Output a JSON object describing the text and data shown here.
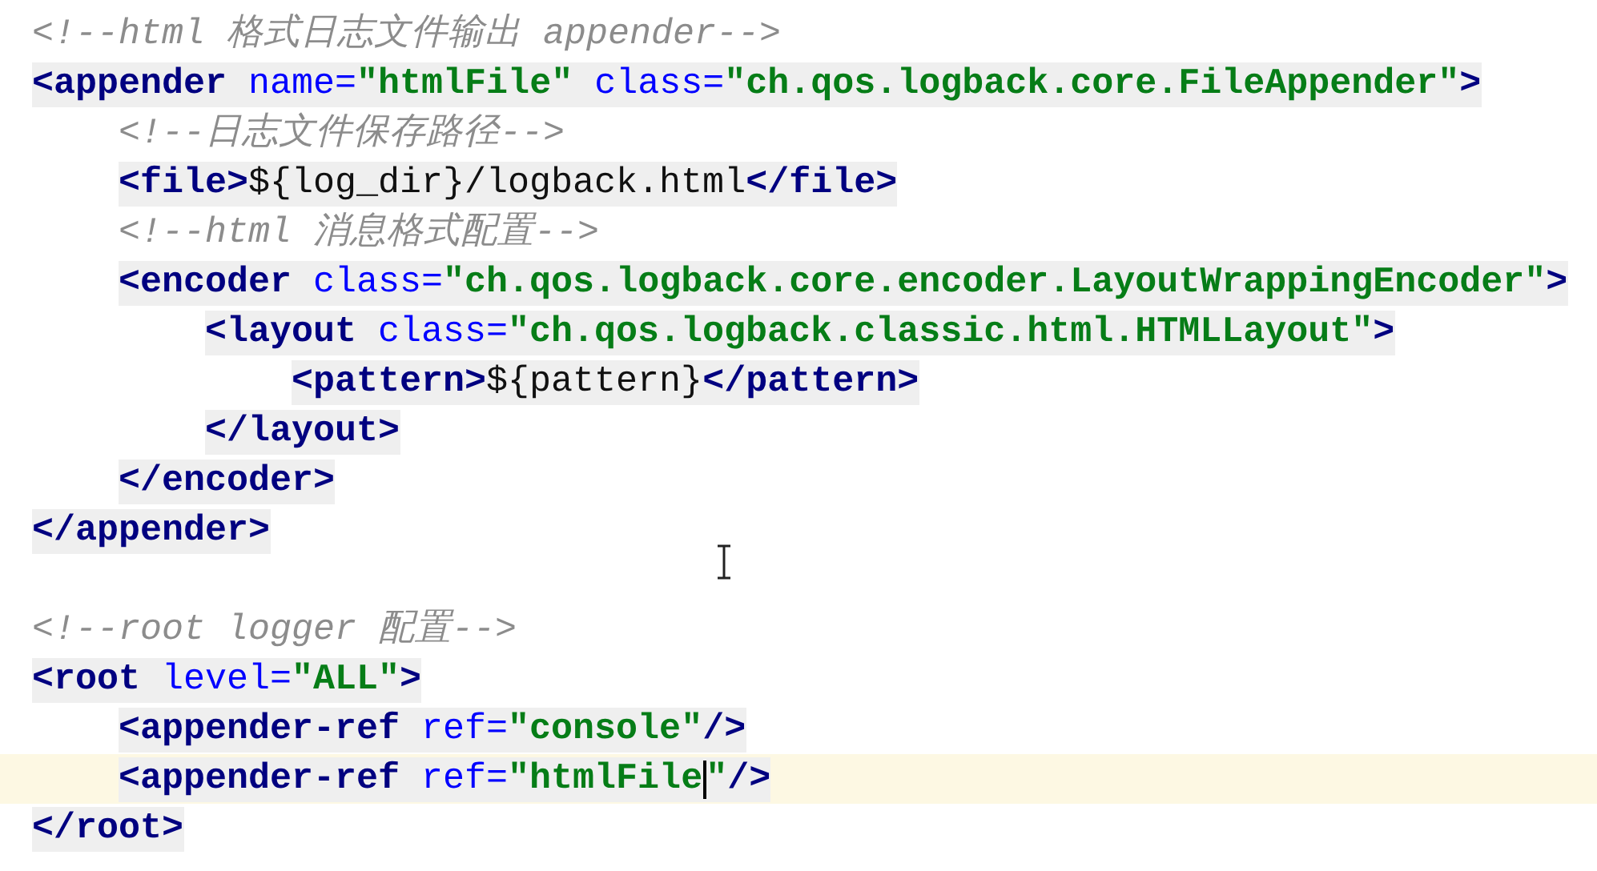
{
  "editor": {
    "lines": [
      {
        "kind": "comment",
        "tokens": [
          {
            "kind": "comment",
            "text": "<!--html 格式日志文件输出 appender-->"
          }
        ]
      },
      {
        "kind": "tag",
        "tokens": [
          {
            "kind": "tag",
            "text": "<appender"
          },
          {
            "kind": "attr",
            "text": " name="
          },
          {
            "kind": "value",
            "text": "\"htmlFile\""
          },
          {
            "kind": "attr",
            "text": " class="
          },
          {
            "kind": "value",
            "text": "\"ch.qos.logback.core.FileAppender\""
          },
          {
            "kind": "tag",
            "text": ">"
          }
        ],
        "children": [
          {
            "kind": "comment",
            "tokens": [
              {
                "kind": "comment",
                "text": "<!--日志文件保存路径-->"
              }
            ]
          },
          {
            "kind": "tag",
            "tokens": [
              {
                "kind": "tag",
                "text": "<file>"
              },
              {
                "kind": "text",
                "text": "${log_dir}/logback.html"
              },
              {
                "kind": "tag",
                "text": "</file>"
              }
            ]
          },
          {
            "kind": "comment",
            "tokens": [
              {
                "kind": "comment",
                "text": "<!--html 消息格式配置-->"
              }
            ]
          },
          {
            "kind": "tag",
            "tokens": [
              {
                "kind": "tag",
                "text": "<encoder"
              },
              {
                "kind": "attr",
                "text": " class="
              },
              {
                "kind": "value",
                "text": "\"ch.qos.logback.core.encoder.LayoutWrappingEncoder\""
              },
              {
                "kind": "tag",
                "text": ">"
              }
            ],
            "children": [
              {
                "kind": "tag",
                "tokens": [
                  {
                    "kind": "tag",
                    "text": "<layout"
                  },
                  {
                    "kind": "attr",
                    "text": " class="
                  },
                  {
                    "kind": "value",
                    "text": "\"ch.qos.logback.classic.html.HTMLLayout\""
                  },
                  {
                    "kind": "tag",
                    "text": ">"
                  }
                ],
                "children": [
                  {
                    "kind": "tag",
                    "tokens": [
                      {
                        "kind": "tag",
                        "text": "<pattern>"
                      },
                      {
                        "kind": "text",
                        "text": "${pattern}"
                      },
                      {
                        "kind": "tag",
                        "text": "</pattern>"
                      }
                    ]
                  }
                ]
              },
              {
                "kind": "tag",
                "tokens": [
                  {
                    "kind": "tag",
                    "text": "</layout>"
                  }
                ]
              }
            ]
          },
          {
            "kind": "tag",
            "tokens": [
              {
                "kind": "tag",
                "text": "</encoder>"
              }
            ]
          }
        ]
      },
      {
        "kind": "tag",
        "tokens": [
          {
            "kind": "tag",
            "text": "</appender>"
          }
        ]
      },
      {
        "kind": "blank"
      },
      {
        "kind": "comment",
        "tokens": [
          {
            "kind": "comment",
            "text": "<!--root logger 配置-->"
          }
        ]
      },
      {
        "kind": "tag",
        "tokens": [
          {
            "kind": "tag",
            "text": "<root"
          },
          {
            "kind": "attr",
            "text": " level="
          },
          {
            "kind": "value",
            "text": "\"ALL\""
          },
          {
            "kind": "tag",
            "text": ">"
          }
        ],
        "children": [
          {
            "kind": "tag",
            "tokens": [
              {
                "kind": "tag",
                "text": "<appender-ref"
              },
              {
                "kind": "attr",
                "text": " ref="
              },
              {
                "kind": "value",
                "text": "\"console\""
              },
              {
                "kind": "tag",
                "text": "/>"
              }
            ]
          },
          {
            "kind": "tag",
            "current": true,
            "tokens": [
              {
                "kind": "tag",
                "text": "<appender-ref"
              },
              {
                "kind": "attr",
                "text": " ref="
              },
              {
                "kind": "value",
                "text": "\"htmlFile"
              },
              {
                "kind": "caret"
              },
              {
                "kind": "value",
                "text": "\""
              },
              {
                "kind": "tag",
                "text": "/>"
              }
            ]
          }
        ]
      },
      {
        "kind": "tag",
        "tokens": [
          {
            "kind": "tag",
            "text": "</root>"
          }
        ]
      }
    ]
  }
}
